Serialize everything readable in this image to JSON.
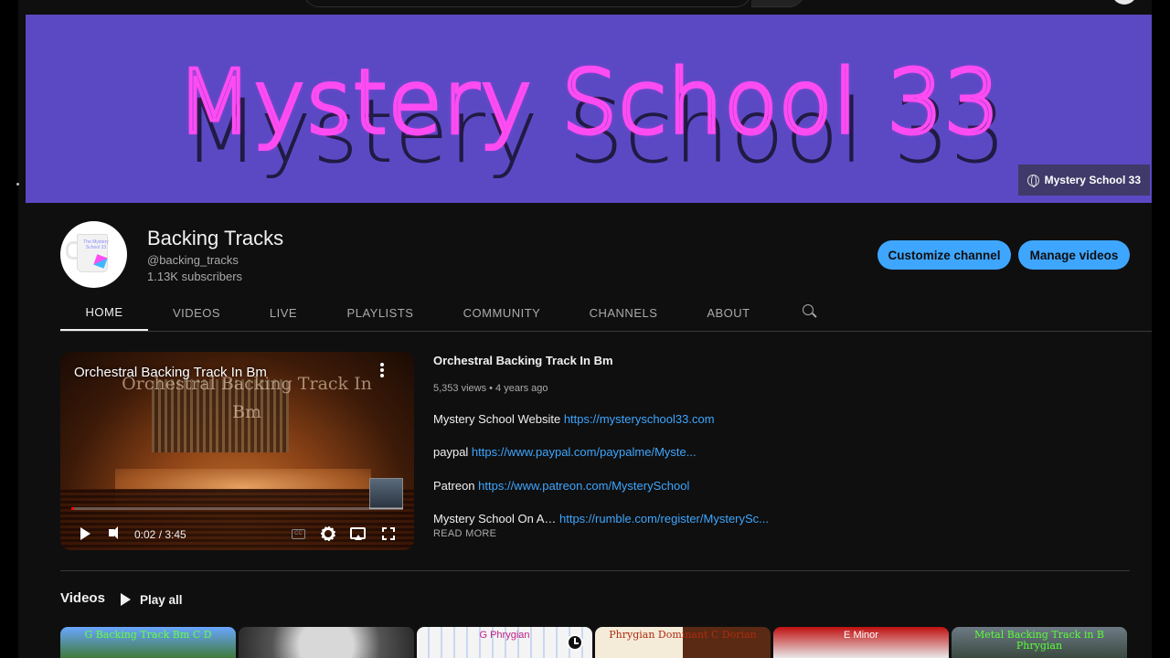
{
  "banner": {
    "title": "Mystery School 33",
    "link_label": "Mystery School 33",
    "background_color": "#5b49c4",
    "text_color": "#ff4cf2"
  },
  "channel": {
    "avatar_text": "The Mystery School 33",
    "name": "Backing Tracks",
    "handle": "@backing_tracks",
    "subscribers": "1.13K subscribers",
    "customize_label": "Customize channel",
    "manage_label": "Manage videos",
    "accent_color": "#3ea6ff"
  },
  "tabs": [
    {
      "label": "HOME",
      "active": true
    },
    {
      "label": "VIDEOS",
      "active": false
    },
    {
      "label": "LIVE",
      "active": false
    },
    {
      "label": "PLAYLISTS",
      "active": false
    },
    {
      "label": "COMMUNITY",
      "active": false
    },
    {
      "label": "CHANNELS",
      "active": false
    },
    {
      "label": "ABOUT",
      "active": false
    }
  ],
  "featured": {
    "overlay_title": "Orchestral Backing Track In Bm",
    "overlay_watermark": "Orchestral Backing Track In Bm",
    "time": "0:02 / 3:45",
    "cc_label": "CC",
    "progress_fraction": 0.009,
    "title": "Orchestral Backing Track In Bm",
    "meta": "5,353 views • 4 years ago",
    "lines": [
      {
        "label": "Mystery School Website ",
        "link": "https://mysteryschool33.com"
      },
      {
        "label": "paypal ",
        "link": "https://www.paypal.com/paypalme/Myste..."
      },
      {
        "label": "Patreon ",
        "link": "https://www.patreon.com/MysterySchool"
      },
      {
        "label": "Mystery School On A… ",
        "link": "https://rumble.com/register/MysterySc..."
      }
    ],
    "read_more": "READ MORE"
  },
  "videos_section": {
    "title": "Videos",
    "play_all": "Play all",
    "thumbnails": [
      {
        "text": "G Backing Track Bm C D"
      },
      {
        "text": ""
      },
      {
        "text": "G Phrygian"
      },
      {
        "text": "Phrygian Dominant C Dorian"
      },
      {
        "text": "E Minor"
      },
      {
        "text": "Metal Backing Track in B Phrygian"
      }
    ]
  }
}
